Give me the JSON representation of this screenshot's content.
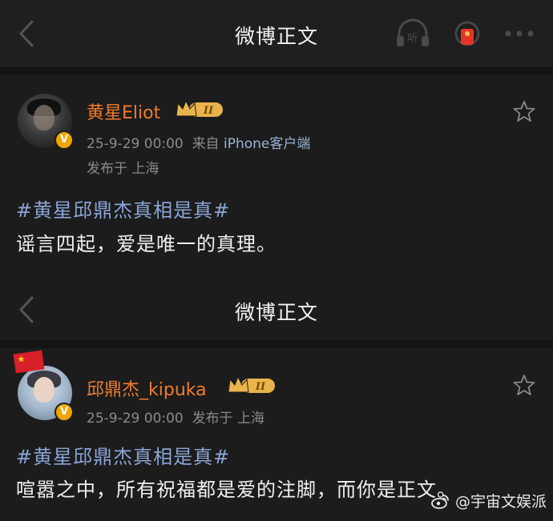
{
  "nav1": {
    "title": "微博正文"
  },
  "post1": {
    "username": "黄星Eliot",
    "level_badge": "II",
    "date": "25-9-29 00:00",
    "source_prefix": "来自",
    "source": "iPhone客户端",
    "location": "发布于 上海",
    "hashtag": "#黄星邱鼎杰真相是真#",
    "text": "谣言四起，爱是唯一的真理。"
  },
  "nav2": {
    "title": "微博正文"
  },
  "post2": {
    "username": "邱鼎杰_kipuka",
    "level_badge": "II",
    "date": "25-9-29 00:00",
    "location": "发布于 上海",
    "hashtag": "#黄星邱鼎杰真相是真#",
    "text": "喧嚣之中，所有祝福都是爱的注脚，而你是正文。"
  },
  "verified_mark": "V",
  "watermark": "@宇宙文娱派",
  "colors": {
    "username": "#f07b2e",
    "hashtag": "#8aa5d6",
    "meta": "#8a8a8a",
    "crown": "#e9b44c",
    "verified": "#f0a500"
  },
  "icons": [
    "back-chevron-icon",
    "listen-headphones-icon",
    "red-packet-icon",
    "more-icon",
    "crown-level-icon",
    "star-outline-icon",
    "verified-icon",
    "china-flag-icon",
    "weibo-logo-icon"
  ]
}
